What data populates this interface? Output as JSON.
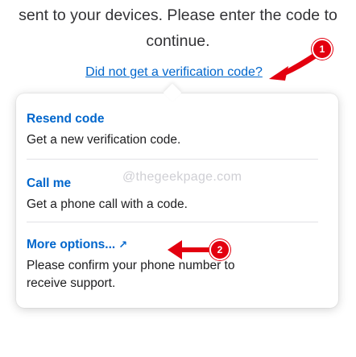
{
  "intro": {
    "line1": "sent to your devices. Please enter the code to",
    "line2": "continue."
  },
  "verify_link": "Did not get a verification code?",
  "watermark": "@thegeekpage.com",
  "options": [
    {
      "title": "Resend code",
      "description": "Get a new verification code."
    },
    {
      "title": "Call me",
      "description": "Get a phone call with a code."
    },
    {
      "title": "More options...",
      "external_icon": "↗",
      "description_line1": "Please confirm your phone number to",
      "description_line2": "receive support."
    }
  ],
  "annotations": {
    "badge1": "1",
    "badge2": "2",
    "color": "#e3000f"
  },
  "colors": {
    "link": "#0066cc",
    "text": "#1d1d1f"
  }
}
